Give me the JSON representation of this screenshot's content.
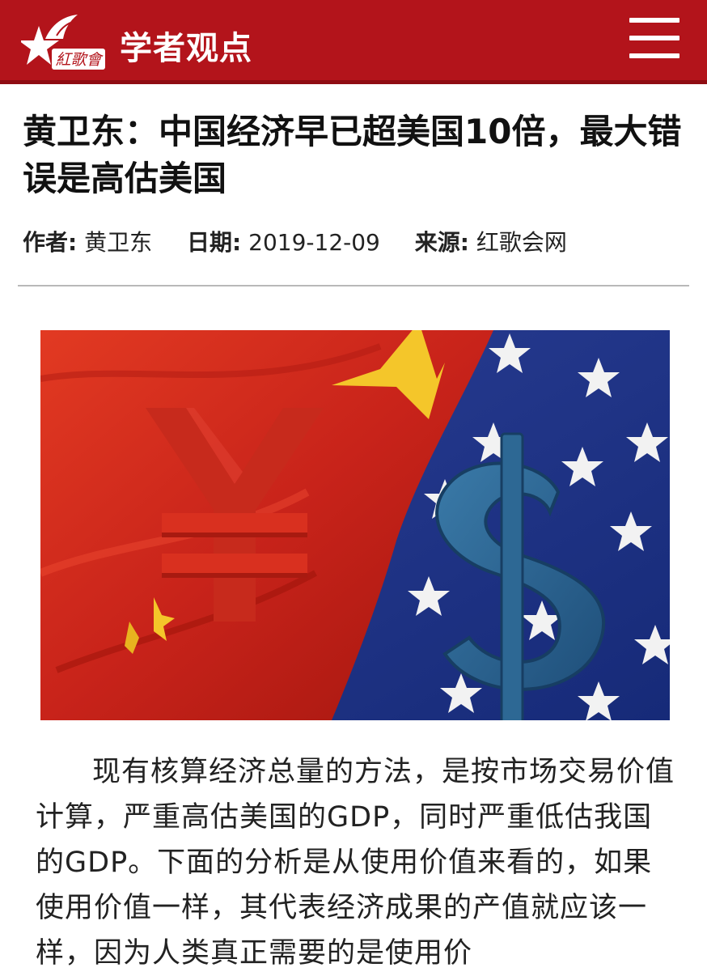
{
  "header": {
    "logo_text": "紅歌會",
    "section_title": "学者观点",
    "menu_icon": "hamburger-menu-icon",
    "brand_color": "#b3141b"
  },
  "article": {
    "title": "黄卫东：中国经济早已超美国10倍，最大错误是高估美国",
    "meta": {
      "author_label": "作者:",
      "author": "黄卫东",
      "date_label": "日期:",
      "date": "2019-12-09",
      "source_label": "来源:",
      "source": "红歌会网"
    },
    "hero_image": {
      "left_symbol": "¥",
      "right_symbol": "$"
    },
    "body": "现有核算经济总量的方法，是按市场交易价值计算，严重高估美国的GDP，同时严重低估我国的GDP。下面的分析是从使用价值来看的，如果使用价值一样，其代表经济成果的产值就应该一样，因为人类真正需要的是使用价"
  }
}
